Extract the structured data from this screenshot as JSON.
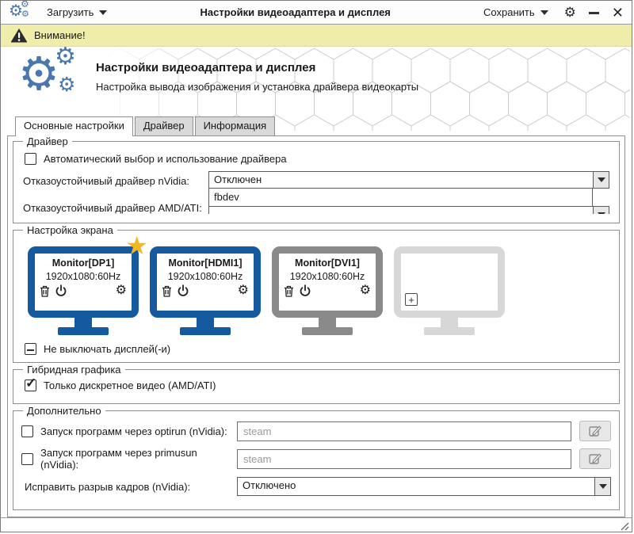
{
  "window": {
    "title": "Настройки видеоадаптера и дисплея",
    "load_button": "Загрузить",
    "save_button": "Сохранить"
  },
  "warning": {
    "text": "Внимание!"
  },
  "header": {
    "title": "Настройки видеоадаптера и дисплея",
    "subtitle": "Настройка вывода изображения и установка драйвера видеокарты"
  },
  "tabs": [
    {
      "label": "Основные настройки",
      "active": true
    },
    {
      "label": "Драйвер",
      "active": false
    },
    {
      "label": "Информация",
      "active": false
    }
  ],
  "driver_group": {
    "title": "Драйвер",
    "auto_checkbox": {
      "label": "Автоматический выбор и использование драйвера",
      "checked": false
    },
    "nvidia_failsafe": {
      "label": "Отказоустойчивый драйвер nVidia:",
      "value": "Отключен"
    },
    "nvidia_dropdown_open_option": "fbdev",
    "amd_failsafe": {
      "label": "Отказоустойчивый драйвер AMD/ATI:"
    }
  },
  "screen_group": {
    "title": "Настройка экрана",
    "monitors": [
      {
        "name": "Monitor[DP1]",
        "mode": "1920x1080:60Hz",
        "primary": true,
        "state": "enabled"
      },
      {
        "name": "Monitor[HDMI1]",
        "mode": "1920x1080:60Hz",
        "primary": false,
        "state": "enabled"
      },
      {
        "name": "Monitor[DVI1]",
        "mode": "1920x1080:60Hz",
        "primary": false,
        "state": "disabled"
      },
      {
        "name": "",
        "mode": "",
        "primary": false,
        "state": "placeholder"
      }
    ],
    "keep_on_checkbox": {
      "label": "Не выключать дисплей(-и)",
      "state": "mixed"
    }
  },
  "hybrid_group": {
    "title": "Гибридная графика",
    "discrete_checkbox": {
      "label": "Только дискретное видео (AMD/ATI)",
      "checked": true
    }
  },
  "extra_group": {
    "title": "Дополнительно",
    "optirun": {
      "label": "Запуск программ через optirun (nVidia):",
      "placeholder": "steam",
      "checked": false
    },
    "primusun": {
      "label": "Запуск программ через primusun (nVidia):",
      "placeholder": "steam",
      "checked": false
    },
    "tearing": {
      "label": "Исправить разрыв кадров (nVidia):",
      "value": "Отключено"
    }
  },
  "colors": {
    "accent_blue": "#155a9e",
    "monitor_gray": "#8a8a8a",
    "monitor_placeholder": "#d7d7d7",
    "star_gold": "#f2b824",
    "warning_bg": "#efeda9",
    "app_icon_blue": "#4a77ad"
  },
  "icons": {
    "app": "gears-icon",
    "warning": "warning-triangle-icon",
    "monitor_actions": [
      "trash-icon",
      "power-icon",
      "gear-icon"
    ],
    "add_monitor": "plus-icon",
    "edit": "pencil-icon"
  }
}
